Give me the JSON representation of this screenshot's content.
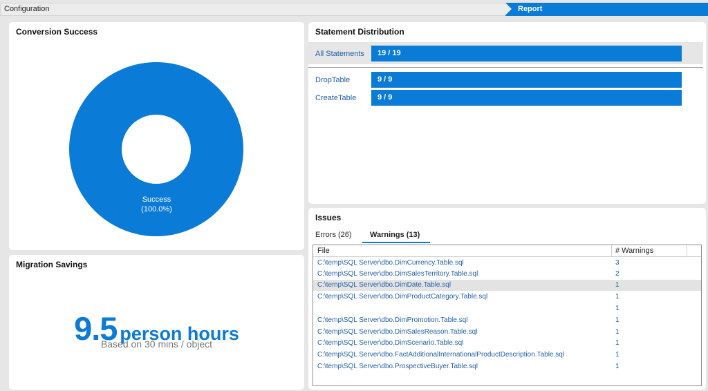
{
  "breadcrumb": {
    "steps": [
      "Configuration",
      "Report"
    ],
    "active": "Report"
  },
  "colors": {
    "accent": "#0a7bd6",
    "link_text": "#1f5fa8"
  },
  "conversion": {
    "title": "Conversion Success",
    "slice_label": "Success",
    "slice_percent": "(100.0%)",
    "success_fraction": 1.0
  },
  "savings": {
    "title": "Migration Savings",
    "value": "9.5",
    "unit": "person hours",
    "note": "Based on 30 mins / object"
  },
  "distribution": {
    "title": "Statement Distribution",
    "all": {
      "label": "All Statements",
      "value": "19 / 19",
      "fraction": 1.0
    },
    "items": [
      {
        "label": "DropTable",
        "value": "9 / 9",
        "fraction": 1.0
      },
      {
        "label": "CreateTable",
        "value": "9 / 9",
        "fraction": 1.0
      }
    ]
  },
  "issues": {
    "title": "Issues",
    "tabs": [
      {
        "label": "Errors (26)",
        "active": false
      },
      {
        "label": "Warnings (13)",
        "active": true
      }
    ],
    "columns": {
      "file": "File",
      "count": "# Warnings"
    },
    "rows": [
      {
        "file": "C:\\temp\\SQL Server\\dbo.DimCurrency.Table.sql",
        "count": "3"
      },
      {
        "file": "C:\\temp\\SQL Server\\dbo.DimSalesTerritory.Table.sql",
        "count": "2"
      },
      {
        "file": "C:\\temp\\SQL Server\\dbo.DimDate.Table.sql",
        "count": "1",
        "selected": true
      },
      {
        "file": "C:\\temp\\SQL Server\\dbo.DimProductCategory.Table.sql",
        "count": "1"
      },
      {
        "file": "",
        "count": "1"
      },
      {
        "file": "C:\\temp\\SQL Server\\dbo.DimPromotion.Table.sql",
        "count": "1"
      },
      {
        "file": "C:\\temp\\SQL Server\\dbo.DimSalesReason.Table.sql",
        "count": "1"
      },
      {
        "file": "C:\\temp\\SQL Server\\dbo.DimScenario.Table.sql",
        "count": "1"
      },
      {
        "file": "C:\\temp\\SQL Server\\dbo.FactAdditionalInternationalProductDescription.Table.sql",
        "count": "1"
      },
      {
        "file": "C:\\temp\\SQL Server\\dbo.ProspectiveBuyer.Table.sql",
        "count": "1"
      }
    ]
  }
}
